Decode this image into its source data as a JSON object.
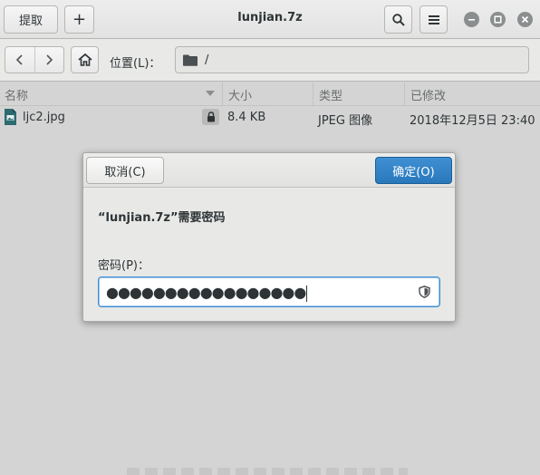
{
  "header": {
    "extract_label": "提取",
    "add_label": "+",
    "title": "lunjian.7z"
  },
  "location": {
    "label": "位置(L)：",
    "path": "/"
  },
  "columns": [
    "名称",
    "大小",
    "类型",
    "已修改"
  ],
  "files": [
    {
      "name": "ljc2.jpg",
      "size": "8.4 KB",
      "type": "JPEG 图像",
      "modified": "2018年12月5日 23:40"
    }
  ],
  "dialog": {
    "cancel_label": "取消(C)",
    "ok_label": "确定(O)",
    "message": "“lunjian.7z”需要密码",
    "field_label": "密码(P)：",
    "password_mask": "●●●●●●●●●●●●●●●●●"
  },
  "colors": {
    "accent": "#2a78bc",
    "window_bg": "#d4d4d4"
  }
}
